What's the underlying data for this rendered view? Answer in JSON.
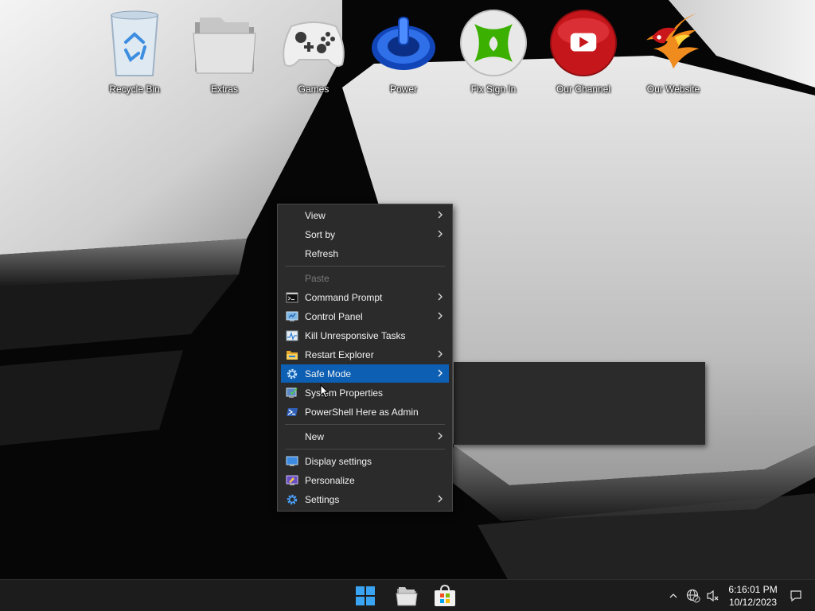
{
  "desktop": {
    "icons": [
      {
        "label": "Recycle Bin"
      },
      {
        "label": "Extras"
      },
      {
        "label": "Games"
      },
      {
        "label": "Power"
      },
      {
        "label": "Fix Sign In"
      },
      {
        "label": "Our Channel"
      },
      {
        "label": "Our Website"
      }
    ]
  },
  "context_menu": {
    "items": [
      {
        "label": "View",
        "submenu": true
      },
      {
        "label": "Sort by",
        "submenu": true
      },
      {
        "label": "Refresh"
      },
      {
        "label": "Paste",
        "disabled": true
      },
      {
        "label": "Command Prompt",
        "icon": "cmd-icon",
        "submenu": true
      },
      {
        "label": "Control Panel",
        "icon": "control-panel-icon",
        "submenu": true
      },
      {
        "label": "Kill Unresponsive Tasks",
        "icon": "task-monitor-icon"
      },
      {
        "label": "Restart Explorer",
        "icon": "folder-icon",
        "submenu": true
      },
      {
        "label": "Safe Mode",
        "icon": "gear-icon",
        "submenu": true,
        "highlighted": true
      },
      {
        "label": "System Properties",
        "icon": "system-properties-icon"
      },
      {
        "label": "PowerShell Here as Admin",
        "icon": "powershell-icon"
      },
      {
        "label": "New",
        "submenu": true
      },
      {
        "label": "Display settings",
        "icon": "display-icon"
      },
      {
        "label": "Personalize",
        "icon": "personalize-icon"
      },
      {
        "label": "Settings",
        "icon": "gear-icon",
        "submenu": true
      }
    ]
  },
  "taskbar": {
    "clock_time": "6:16:01 PM",
    "clock_date": "10/12/2023"
  },
  "colors": {
    "menu_bg": "#2b2b2b",
    "menu_highlight": "#0d5fb3",
    "taskbar_bg": "#1c1c1c"
  }
}
